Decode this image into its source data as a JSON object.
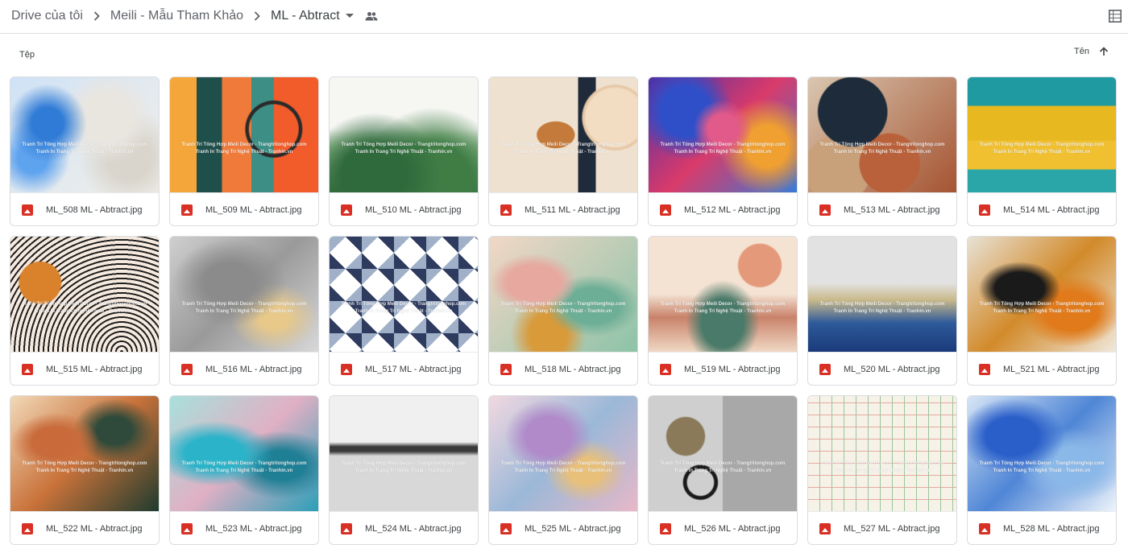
{
  "breadcrumb": {
    "items": [
      "Drive của tôi",
      "Meili - Mẫu Tham Khảo",
      "ML - Abtract"
    ]
  },
  "header": {
    "icons": {
      "separator": "chevron-right-icon",
      "dropdown": "caret-down-icon",
      "shared": "shared-people-icon",
      "view": "grid-view-icon"
    }
  },
  "section": {
    "label": "Tệp",
    "sort_label": "Tên",
    "sort_direction": "ascending"
  },
  "files": [
    {
      "name": "ML_508 ML - Abtract.jpg"
    },
    {
      "name": "ML_509 ML - Abtract.jpg"
    },
    {
      "name": "ML_510 ML - Abtract.jpg"
    },
    {
      "name": "ML_511 ML - Abtract.jpg"
    },
    {
      "name": "ML_512 ML - Abtract.jpg"
    },
    {
      "name": "ML_513 ML - Abtract.jpg"
    },
    {
      "name": "ML_514 ML - Abtract.jpg"
    },
    {
      "name": "ML_515 ML - Abtract.jpg"
    },
    {
      "name": "ML_516 ML - Abtract.jpg"
    },
    {
      "name": "ML_517 ML - Abtract.jpg"
    },
    {
      "name": "ML_518 ML - Abtract.jpg"
    },
    {
      "name": "ML_519 ML - Abtract.jpg"
    },
    {
      "name": "ML_520 ML - Abtract.jpg"
    },
    {
      "name": "ML_521 ML - Abtract.jpg"
    },
    {
      "name": "ML_522 ML - Abtract.jpg"
    },
    {
      "name": "ML_523 ML - Abtract.jpg"
    },
    {
      "name": "ML_524 ML - Abtract.jpg"
    },
    {
      "name": "ML_525 ML - Abtract.jpg"
    },
    {
      "name": "ML_526 ML - Abtract.jpg"
    },
    {
      "name": "ML_527 ML - Abtract.jpg"
    },
    {
      "name": "ML_528 ML - Abtract.jpg"
    }
  ],
  "thumbnail_watermark": [
    "Tranh Trí Tổng Hợp Meili Decor - Trangtritonghop.com",
    "Tranh In Trang Trí Nghệ Thuật - Tranhin.vn"
  ],
  "colors": {
    "image_icon": "#d93025",
    "text": "#3c4043",
    "divider": "#dadce0"
  }
}
